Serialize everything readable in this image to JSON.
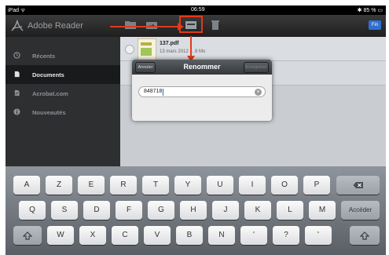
{
  "statusbar": {
    "left": "iPad ᯤ",
    "time": "06:59",
    "right": "✱ 85 % ▭"
  },
  "toolbar": {
    "app_title": "Adobe Reader",
    "button_label": "Fin",
    "icons": [
      "folder-icon",
      "folder-move-icon",
      "rename-icon",
      "trash-icon"
    ],
    "highlight_color": "#e23a1a"
  },
  "sidebar": {
    "items": [
      {
        "label": "Récents",
        "icon": "clock-icon"
      },
      {
        "label": "Documents",
        "icon": "document-icon"
      },
      {
        "label": "Acrobat.com",
        "icon": "acrobat-icon"
      },
      {
        "label": "Nouveautés",
        "icon": "info-icon"
      }
    ]
  },
  "files": [
    {
      "name": "137.pdf",
      "meta": "13 mars 2012 ... 8 Mo"
    }
  ],
  "dialog": {
    "cancel": "Annuler",
    "title": "Renommer",
    "save": "Enregistrer",
    "input_value": "848718"
  },
  "keyboard": {
    "row1": [
      "A",
      "Z",
      "E",
      "R",
      "T",
      "Y",
      "U",
      "I",
      "O",
      "P"
    ],
    "row2": [
      "Q",
      "S",
      "D",
      "F",
      "G",
      "H",
      "J",
      "K",
      "L",
      "M"
    ],
    "row3": [
      "W",
      "X",
      "C",
      "V",
      "B",
      "N",
      "'",
      "?",
      "'"
    ],
    "return_label": "Accéder",
    "backspace_icon": "backspace-icon",
    "shift_icon": "shift-icon"
  }
}
